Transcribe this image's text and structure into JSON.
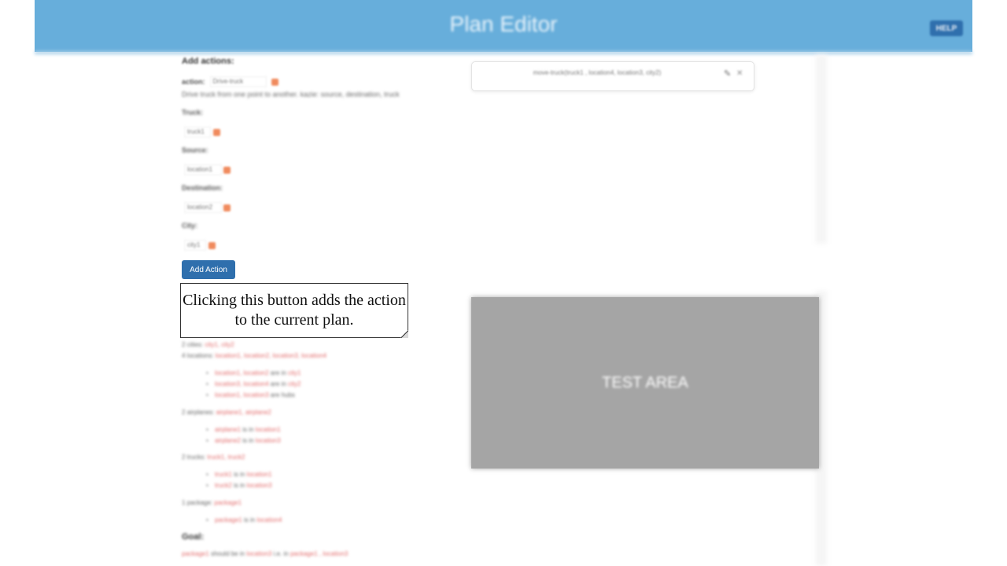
{
  "header": {
    "title": "Plan Editor",
    "help_label": "HELP"
  },
  "add_actions": {
    "heading": "Add actions:",
    "action_label": "action:",
    "action_value": "Drive-truck",
    "action_description": "Drive truck from one point to another. kazie: source, destination, truck",
    "params": [
      {
        "label": "Truck:",
        "value": "truck1"
      },
      {
        "label": "Source:",
        "value": "location1"
      },
      {
        "label": "Destination:",
        "value": "location2"
      },
      {
        "label": "City:",
        "value": "city1"
      }
    ],
    "add_action_label": "Add Action"
  },
  "callout": {
    "text": "Clicking this button adds the action to the current plan."
  },
  "state": {
    "cities": {
      "prefix": "2 cities:",
      "items": "city1, city2"
    },
    "locations": {
      "prefix": "4 locations:",
      "items": "location1, location2, location3, location4"
    },
    "location_facts": [
      {
        "a": "location1, location2",
        "rel": "are in",
        "b": "city1"
      },
      {
        "a": "location3, location4",
        "rel": "are in",
        "b": "city2"
      },
      {
        "a": "location1, location3",
        "rel": "are hubs",
        "b": ""
      }
    ],
    "airplanes": {
      "prefix": "2 airplanes:",
      "items": "airplane1, airplane2"
    },
    "airplane_facts": [
      {
        "a": "airplane1",
        "rel": "is in",
        "b": "location1"
      },
      {
        "a": "airplane2",
        "rel": "is in",
        "b": "location3"
      }
    ],
    "trucks": {
      "prefix": "2 trucks:",
      "items": "truck1, truck2"
    },
    "truck_facts": [
      {
        "a": "truck1",
        "rel": "is in",
        "b": "location1"
      },
      {
        "a": "truck2",
        "rel": "is in",
        "b": "location3"
      }
    ],
    "packages": {
      "prefix": "1 package:",
      "items": "package1"
    },
    "package_facts": [
      {
        "a": "package1",
        "rel": "is in",
        "b": "location4"
      }
    ],
    "goal_heading": "Goal:",
    "goal_a": "package1",
    "goal_rel": "should be in",
    "goal_b": "location3",
    "goal_rest": "i.e. in",
    "goal_c": "package1 , location3"
  },
  "plan": {
    "steps": [
      "move-truck(truck1 , location4, location3, city2)"
    ]
  },
  "test_area": {
    "label": "TEST AREA"
  }
}
